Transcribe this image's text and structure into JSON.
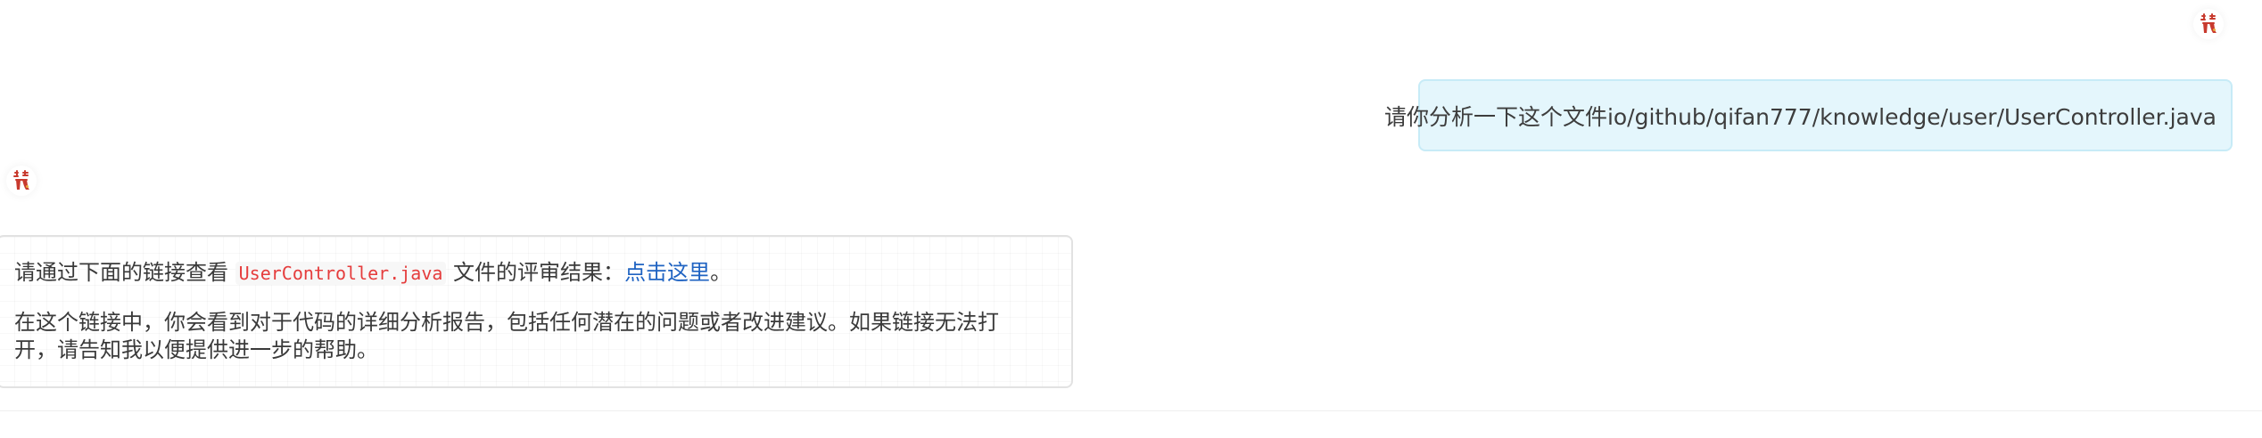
{
  "conversation": {
    "user_message": {
      "text": "请你分析一下这个文件io/github/qifan777/knowledge/user/UserController.java"
    },
    "bot_message": {
      "line1_prefix": "请通过下面的链接查看 ",
      "line1_code": "UserController.java",
      "line1_mid": " 文件的评审结果：",
      "line1_link": "点击这里",
      "line1_suffix": "。",
      "paragraph2": "在这个链接中，你会看到对于代码的详细分析报告，包括任何潜在的问题或者改进建议。如果链接无法打开，请告知我以便提供进一步的帮助。"
    },
    "avatar_icon": "chef-avatar-icon"
  },
  "colors": {
    "user_bubble_bg": "#e4f6fc",
    "user_bubble_border": "#c7ebf7",
    "link": "#1f63c2",
    "inline_code": "#e53c3c"
  }
}
